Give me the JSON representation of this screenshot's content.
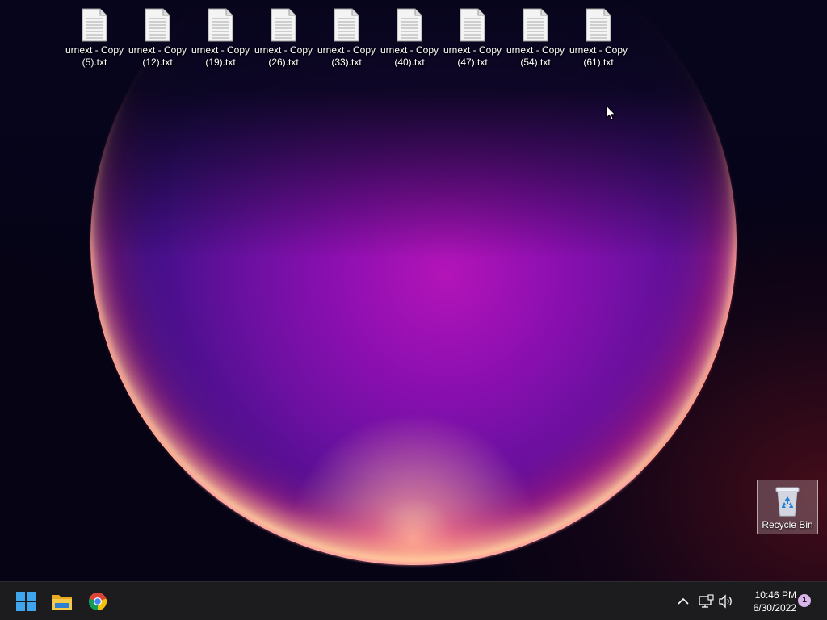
{
  "desktop": {
    "files": [
      {
        "name_line1": "urnext - Copy",
        "name_line2": "(5).txt",
        "icon": "text-file-icon"
      },
      {
        "name_line1": "urnext - Copy",
        "name_line2": "(12).txt",
        "icon": "text-file-icon"
      },
      {
        "name_line1": "urnext - Copy",
        "name_line2": "(19).txt",
        "icon": "text-file-icon"
      },
      {
        "name_line1": "urnext - Copy",
        "name_line2": "(26).txt",
        "icon": "text-file-icon"
      },
      {
        "name_line1": "urnext - Copy",
        "name_line2": "(33).txt",
        "icon": "text-file-icon"
      },
      {
        "name_line1": "urnext - Copy",
        "name_line2": "(40).txt",
        "icon": "text-file-icon"
      },
      {
        "name_line1": "urnext - Copy",
        "name_line2": "(47).txt",
        "icon": "text-file-icon"
      },
      {
        "name_line1": "urnext - Copy",
        "name_line2": "(54).txt",
        "icon": "text-file-icon"
      },
      {
        "name_line1": "urnext - Copy",
        "name_line2": "(61).txt",
        "icon": "text-file-icon"
      }
    ],
    "recycle_bin": {
      "label": "Recycle Bin",
      "icon": "recycle-bin-icon",
      "selected": true
    }
  },
  "taskbar": {
    "pinned": [
      {
        "name": "start-button",
        "icon": "windows-logo-icon"
      },
      {
        "name": "file-explorer-button",
        "icon": "folder-icon"
      },
      {
        "name": "chrome-button",
        "icon": "chrome-icon"
      }
    ],
    "tray": {
      "icons": [
        "chevron-up-icon",
        "network-icon",
        "volume-icon"
      ],
      "time": "10:46 PM",
      "date": "6/30/2022",
      "notification_count": "1"
    }
  },
  "colors": {
    "taskbar_bg": "#1c1c1f",
    "accent_blue": "#1e90ff",
    "badge": "#d8b4e8"
  }
}
